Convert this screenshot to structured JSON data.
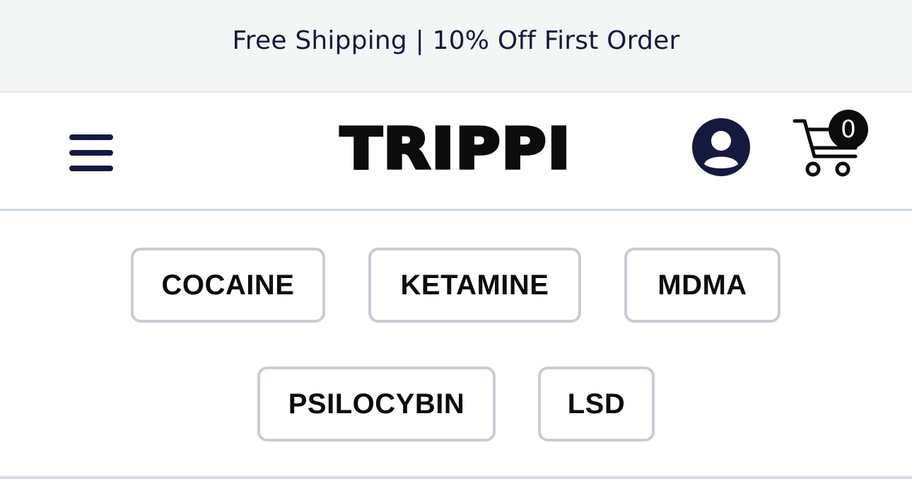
{
  "announcement": {
    "text": "Free Shipping | 10% Off First Order"
  },
  "header": {
    "logo_text": "TRIPPI",
    "menu_icon": "hamburger-menu-icon",
    "account_icon": "user-account-icon",
    "cart_icon": "shopping-cart-icon",
    "cart_count": "0"
  },
  "categories": {
    "items": [
      {
        "label": "COCAINE"
      },
      {
        "label": "KETAMINE"
      },
      {
        "label": "MDMA"
      },
      {
        "label": "PSILOCYBIN"
      },
      {
        "label": "LSD"
      }
    ]
  },
  "colors": {
    "brand_navy": "#16193f",
    "banner_bg": "#f4f5f5",
    "tag_border": "#c8ccd4",
    "text_black": "#0c0c0c"
  }
}
